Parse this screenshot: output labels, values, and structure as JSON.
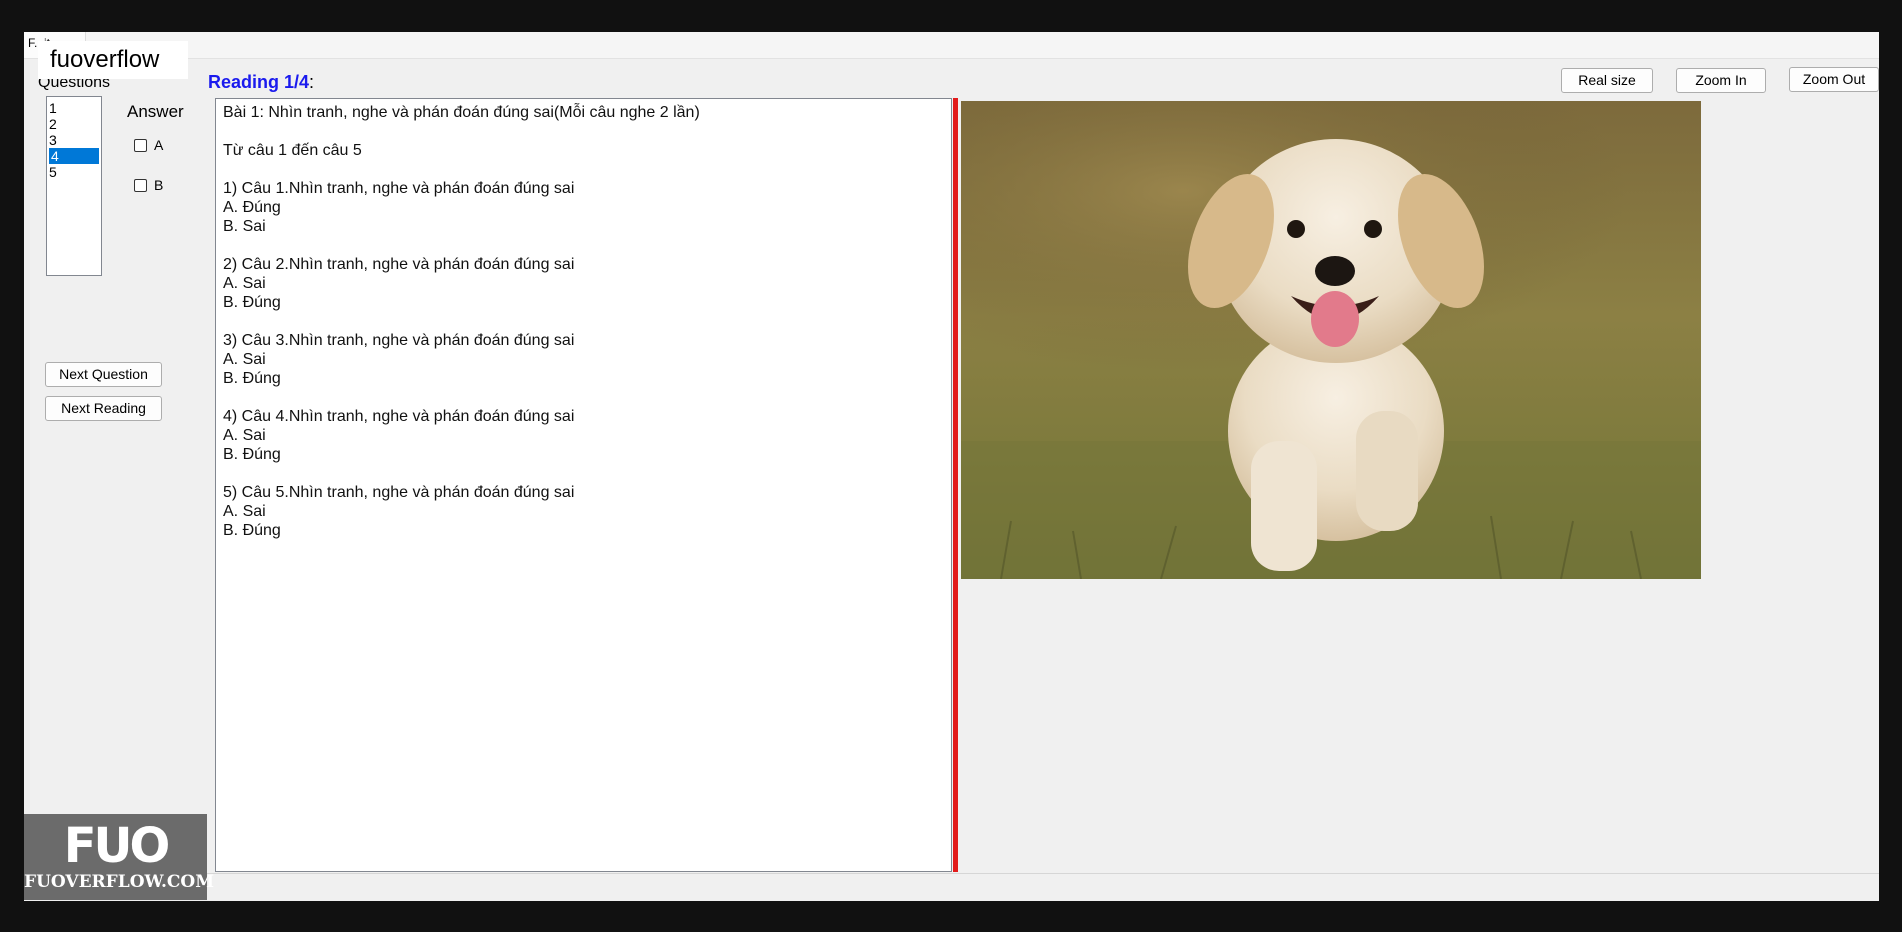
{
  "window": {
    "menu_tab": "F...it",
    "watermark": "fuoverflow"
  },
  "questions_panel": {
    "label": "Questions",
    "items": [
      "1",
      "2",
      "3",
      "4",
      "5"
    ],
    "selected_item": "4"
  },
  "answer_panel": {
    "label": "Answer",
    "choices": [
      "A",
      "B"
    ]
  },
  "buttons": {
    "next_question": "Next Question",
    "next_reading": "Next Reading",
    "real_size": "Real size",
    "zoom_in": "Zoom In",
    "zoom_out": "Zoom Out"
  },
  "reading": {
    "title": "Reading 1/4",
    "colon": ":",
    "lines": [
      "Bài 1: Nhìn tranh, nghe và phán đoán đúng sai(Mỗi câu nghe 2 lần)",
      "",
      "Từ câu 1 đến câu 5",
      "",
      "1) Câu 1.Nhìn tranh, nghe và phán đoán đúng sai",
      "A. Đúng",
      "B. Sai",
      "",
      "2) Câu 2.Nhìn tranh, nghe và phán đoán đúng sai",
      "A. Sai",
      "B. Đúng",
      "",
      "3) Câu 3.Nhìn tranh, nghe và phán đoán đúng sai",
      "A. Sai",
      "B. Đúng",
      "",
      "4) Câu 4.Nhìn tranh, nghe và phán đoán đúng sai",
      "A. Sai",
      "B. Đúng",
      "",
      "5) Câu 5.Nhìn tranh, nghe và phán đoán đúng sai",
      "A. Sai",
      "B. Đúng"
    ]
  },
  "logo": {
    "mark": "FUO",
    "site": "FUOVERFLOW.COM"
  },
  "colors": {
    "title_blue": "#1a1aee",
    "selection": "#0078d7",
    "splitter": "#e21b1b"
  }
}
